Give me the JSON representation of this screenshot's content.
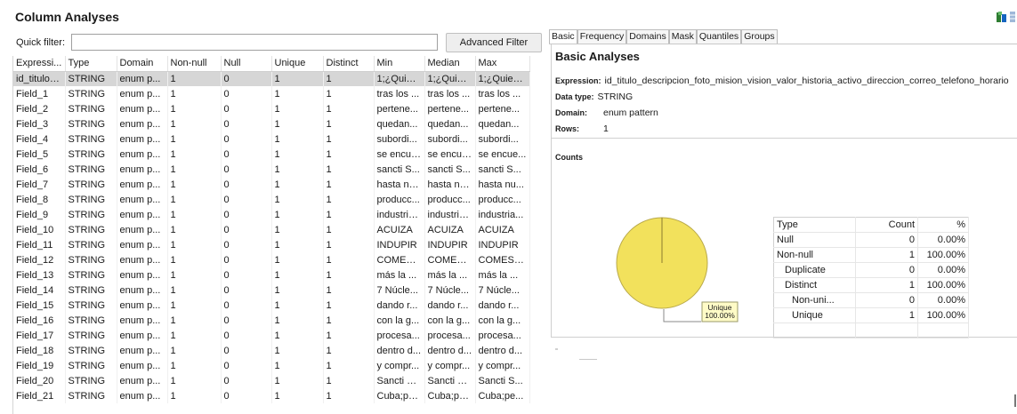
{
  "app": {
    "title": "Column Analyses"
  },
  "filter": {
    "label": "Quick filter:",
    "value": "",
    "placeholder": "",
    "advanced_button": "Advanced Filter"
  },
  "columns_table": {
    "headers": [
      "Expressi...",
      "Type",
      "Domain",
      "Non-null",
      "Null",
      "Unique",
      "Distinct",
      "Min",
      "Median",
      "Max"
    ],
    "rows": [
      [
        "id_titulo_...",
        "STRING",
        "enum p...",
        "1",
        "0",
        "1",
        "1",
        "1;¿Quien...",
        "1;¿Quien...",
        "1;¿Quien..."
      ],
      [
        "Field_1",
        "STRING",
        "enum p...",
        "1",
        "0",
        "1",
        "1",
        "tras los ...",
        "tras los ...",
        "tras los ..."
      ],
      [
        "Field_2",
        "STRING",
        "enum p...",
        "1",
        "0",
        "1",
        "1",
        "pertene...",
        "pertene...",
        "pertene..."
      ],
      [
        "Field_3",
        "STRING",
        "enum p...",
        "1",
        "0",
        "1",
        "1",
        "quedan...",
        "quedan...",
        "quedan..."
      ],
      [
        "Field_4",
        "STRING",
        "enum p...",
        "1",
        "0",
        "1",
        "1",
        "subordi...",
        "subordi...",
        "subordi..."
      ],
      [
        "Field_5",
        "STRING",
        "enum p...",
        "1",
        "0",
        "1",
        "1",
        "se encue...",
        "se encue...",
        "se encue..."
      ],
      [
        "Field_6",
        "STRING",
        "enum p...",
        "1",
        "0",
        "1",
        "1",
        "sancti S...",
        "sancti S...",
        "sancti S..."
      ],
      [
        "Field_7",
        "STRING",
        "enum p...",
        "1",
        "0",
        "1",
        "1",
        "hasta nu...",
        "hasta nu...",
        "hasta nu..."
      ],
      [
        "Field_8",
        "STRING",
        "enum p...",
        "1",
        "0",
        "1",
        "1",
        "producc...",
        "producc...",
        "producc..."
      ],
      [
        "Field_9",
        "STRING",
        "enum p...",
        "1",
        "0",
        "1",
        "1",
        "industria...",
        "industria...",
        "industria..."
      ],
      [
        "Field_10",
        "STRING",
        "enum p...",
        "1",
        "0",
        "1",
        "1",
        "ACUIZA",
        "ACUIZA",
        "ACUIZA"
      ],
      [
        "Field_11",
        "STRING",
        "enum p...",
        "1",
        "0",
        "1",
        "1",
        "INDUPIR",
        "INDUPIR",
        "INDUPIR"
      ],
      [
        "Field_12",
        "STRING",
        "enum p...",
        "1",
        "0",
        "1",
        "1",
        "COMESP...",
        "COMESP...",
        "COMESP..."
      ],
      [
        "Field_13",
        "STRING",
        "enum p...",
        "1",
        "0",
        "1",
        "1",
        "más la ...",
        "más la ...",
        "más la ..."
      ],
      [
        "Field_14",
        "STRING",
        "enum p...",
        "1",
        "0",
        "1",
        "1",
        "7 Núcle...",
        "7 Núcle...",
        "7 Núcle..."
      ],
      [
        "Field_15",
        "STRING",
        "enum p...",
        "1",
        "0",
        "1",
        "1",
        "dando r...",
        "dando r...",
        "dando r..."
      ],
      [
        "Field_16",
        "STRING",
        "enum p...",
        "1",
        "0",
        "1",
        "1",
        "con la g...",
        "con la g...",
        "con la g..."
      ],
      [
        "Field_17",
        "STRING",
        "enum p...",
        "1",
        "0",
        "1",
        "1",
        "procesa...",
        "procesa...",
        "procesa..."
      ],
      [
        "Field_18",
        "STRING",
        "enum p...",
        "1",
        "0",
        "1",
        "1",
        "dentro d...",
        "dentro d...",
        "dentro d..."
      ],
      [
        "Field_19",
        "STRING",
        "enum p...",
        "1",
        "0",
        "1",
        "1",
        "y compr...",
        "y compr...",
        "y compr..."
      ],
      [
        "Field_20",
        "STRING",
        "enum p...",
        "1",
        "0",
        "1",
        "1",
        "Sancti S...",
        "Sancti S...",
        "Sancti S..."
      ],
      [
        "Field_21",
        "STRING",
        "enum p...",
        "1",
        "0",
        "1",
        "1",
        "Cuba;pe...",
        "Cuba;pe...",
        "Cuba;pe..."
      ]
    ],
    "selected_row": 0
  },
  "tabs": [
    "Basic",
    "Frequency",
    "Domains",
    "Mask",
    "Quantiles",
    "Groups"
  ],
  "basic": {
    "title": "Basic Analyses",
    "expression_label": "Expression:",
    "expression_value": "id_titulo_descripcion_foto_mision_vision_valor_historia_activo_direccion_correo_telefono_horario",
    "data_type_label": "Data type:",
    "data_type_value": "STRING",
    "domain_label": "Domain:",
    "domain_value": "enum pattern",
    "rows_label": "Rows:",
    "rows_value": "1",
    "counts_title": "Counts"
  },
  "pie": {
    "label_line1": "Unique",
    "label_line2": "100.00%",
    "fraction": 1.0,
    "color": "#f2e15c"
  },
  "counts_table": {
    "headers": [
      "Type",
      "Count",
      "%"
    ],
    "rows": [
      {
        "type": "Null",
        "count": "0",
        "pct": "0.00%"
      },
      {
        "type": "Non-null",
        "count": "1",
        "pct": "100.00%"
      },
      {
        "type": "Duplicate",
        "count": "0",
        "pct": "0.00%"
      },
      {
        "type": "Distinct",
        "count": "1",
        "pct": "100.00%"
      },
      {
        "type": "Non-uni...",
        "count": "0",
        "pct": "0.00%"
      },
      {
        "type": "Unique",
        "count": "1",
        "pct": "100.00%"
      }
    ]
  },
  "colors": {
    "selected_row": "#d6d6d6",
    "pie_fill": "#f2e15c",
    "label_box": "#fffbc7"
  }
}
